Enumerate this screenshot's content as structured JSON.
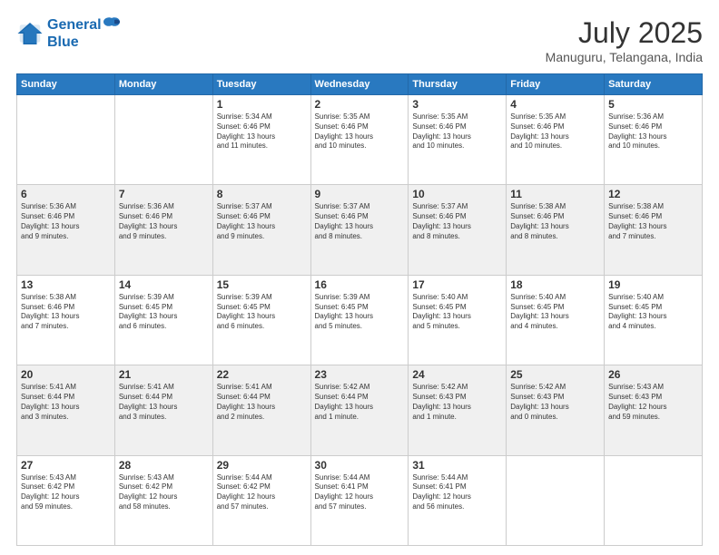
{
  "header": {
    "logo_line1": "General",
    "logo_line2": "Blue",
    "month_title": "July 2025",
    "location": "Manuguru, Telangana, India"
  },
  "weekdays": [
    "Sunday",
    "Monday",
    "Tuesday",
    "Wednesday",
    "Thursday",
    "Friday",
    "Saturday"
  ],
  "weeks": [
    [
      {
        "day": "",
        "info": ""
      },
      {
        "day": "",
        "info": ""
      },
      {
        "day": "1",
        "info": "Sunrise: 5:34 AM\nSunset: 6:46 PM\nDaylight: 13 hours\nand 11 minutes."
      },
      {
        "day": "2",
        "info": "Sunrise: 5:35 AM\nSunset: 6:46 PM\nDaylight: 13 hours\nand 10 minutes."
      },
      {
        "day": "3",
        "info": "Sunrise: 5:35 AM\nSunset: 6:46 PM\nDaylight: 13 hours\nand 10 minutes."
      },
      {
        "day": "4",
        "info": "Sunrise: 5:35 AM\nSunset: 6:46 PM\nDaylight: 13 hours\nand 10 minutes."
      },
      {
        "day": "5",
        "info": "Sunrise: 5:36 AM\nSunset: 6:46 PM\nDaylight: 13 hours\nand 10 minutes."
      }
    ],
    [
      {
        "day": "6",
        "info": "Sunrise: 5:36 AM\nSunset: 6:46 PM\nDaylight: 13 hours\nand 9 minutes."
      },
      {
        "day": "7",
        "info": "Sunrise: 5:36 AM\nSunset: 6:46 PM\nDaylight: 13 hours\nand 9 minutes."
      },
      {
        "day": "8",
        "info": "Sunrise: 5:37 AM\nSunset: 6:46 PM\nDaylight: 13 hours\nand 9 minutes."
      },
      {
        "day": "9",
        "info": "Sunrise: 5:37 AM\nSunset: 6:46 PM\nDaylight: 13 hours\nand 8 minutes."
      },
      {
        "day": "10",
        "info": "Sunrise: 5:37 AM\nSunset: 6:46 PM\nDaylight: 13 hours\nand 8 minutes."
      },
      {
        "day": "11",
        "info": "Sunrise: 5:38 AM\nSunset: 6:46 PM\nDaylight: 13 hours\nand 8 minutes."
      },
      {
        "day": "12",
        "info": "Sunrise: 5:38 AM\nSunset: 6:46 PM\nDaylight: 13 hours\nand 7 minutes."
      }
    ],
    [
      {
        "day": "13",
        "info": "Sunrise: 5:38 AM\nSunset: 6:46 PM\nDaylight: 13 hours\nand 7 minutes."
      },
      {
        "day": "14",
        "info": "Sunrise: 5:39 AM\nSunset: 6:45 PM\nDaylight: 13 hours\nand 6 minutes."
      },
      {
        "day": "15",
        "info": "Sunrise: 5:39 AM\nSunset: 6:45 PM\nDaylight: 13 hours\nand 6 minutes."
      },
      {
        "day": "16",
        "info": "Sunrise: 5:39 AM\nSunset: 6:45 PM\nDaylight: 13 hours\nand 5 minutes."
      },
      {
        "day": "17",
        "info": "Sunrise: 5:40 AM\nSunset: 6:45 PM\nDaylight: 13 hours\nand 5 minutes."
      },
      {
        "day": "18",
        "info": "Sunrise: 5:40 AM\nSunset: 6:45 PM\nDaylight: 13 hours\nand 4 minutes."
      },
      {
        "day": "19",
        "info": "Sunrise: 5:40 AM\nSunset: 6:45 PM\nDaylight: 13 hours\nand 4 minutes."
      }
    ],
    [
      {
        "day": "20",
        "info": "Sunrise: 5:41 AM\nSunset: 6:44 PM\nDaylight: 13 hours\nand 3 minutes."
      },
      {
        "day": "21",
        "info": "Sunrise: 5:41 AM\nSunset: 6:44 PM\nDaylight: 13 hours\nand 3 minutes."
      },
      {
        "day": "22",
        "info": "Sunrise: 5:41 AM\nSunset: 6:44 PM\nDaylight: 13 hours\nand 2 minutes."
      },
      {
        "day": "23",
        "info": "Sunrise: 5:42 AM\nSunset: 6:44 PM\nDaylight: 13 hours\nand 1 minute."
      },
      {
        "day": "24",
        "info": "Sunrise: 5:42 AM\nSunset: 6:43 PM\nDaylight: 13 hours\nand 1 minute."
      },
      {
        "day": "25",
        "info": "Sunrise: 5:42 AM\nSunset: 6:43 PM\nDaylight: 13 hours\nand 0 minutes."
      },
      {
        "day": "26",
        "info": "Sunrise: 5:43 AM\nSunset: 6:43 PM\nDaylight: 12 hours\nand 59 minutes."
      }
    ],
    [
      {
        "day": "27",
        "info": "Sunrise: 5:43 AM\nSunset: 6:42 PM\nDaylight: 12 hours\nand 59 minutes."
      },
      {
        "day": "28",
        "info": "Sunrise: 5:43 AM\nSunset: 6:42 PM\nDaylight: 12 hours\nand 58 minutes."
      },
      {
        "day": "29",
        "info": "Sunrise: 5:44 AM\nSunset: 6:42 PM\nDaylight: 12 hours\nand 57 minutes."
      },
      {
        "day": "30",
        "info": "Sunrise: 5:44 AM\nSunset: 6:41 PM\nDaylight: 12 hours\nand 57 minutes."
      },
      {
        "day": "31",
        "info": "Sunrise: 5:44 AM\nSunset: 6:41 PM\nDaylight: 12 hours\nand 56 minutes."
      },
      {
        "day": "",
        "info": ""
      },
      {
        "day": "",
        "info": ""
      }
    ]
  ]
}
